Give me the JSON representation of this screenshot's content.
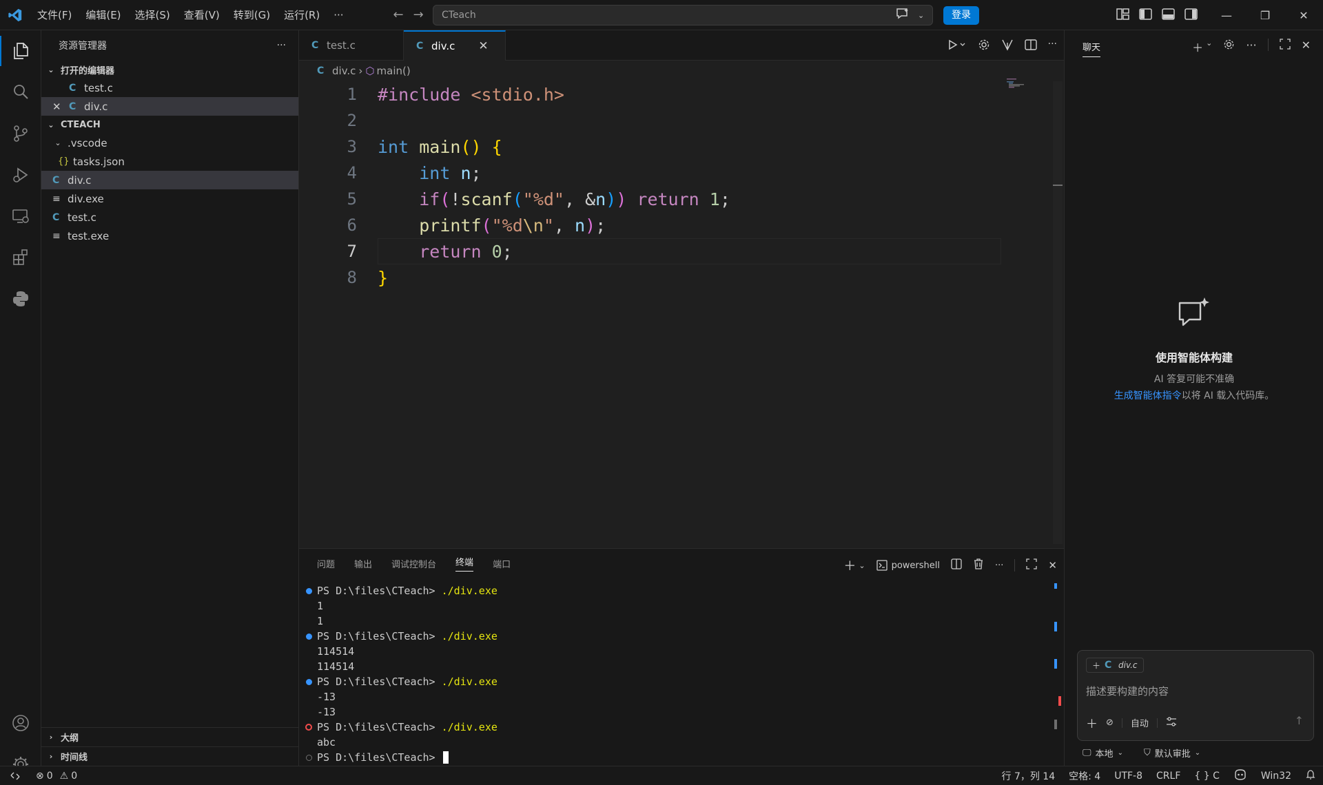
{
  "titlebar": {
    "menus": [
      "文件(F)",
      "编辑(E)",
      "选择(S)",
      "查看(V)",
      "转到(G)",
      "运行(R)",
      "···"
    ],
    "search_text": "CTeach",
    "login_label": "登录"
  },
  "sidebar": {
    "title": "资源管理器",
    "more": "···",
    "open_editors_label": "打开的编辑器",
    "open_editors": [
      {
        "name": "test.c"
      },
      {
        "name": "div.c"
      }
    ],
    "folder_label": "CTEACH",
    "tree": [
      {
        "name": ".vscode",
        "icon": "folder"
      },
      {
        "name": "tasks.json",
        "icon": "json"
      },
      {
        "name": "div.c",
        "icon": "c"
      },
      {
        "name": "div.exe",
        "icon": "exe"
      },
      {
        "name": "test.c",
        "icon": "c"
      },
      {
        "name": "test.exe",
        "icon": "exe"
      }
    ],
    "outline_label": "大纲",
    "timeline_label": "时间线"
  },
  "editor": {
    "tabs": [
      {
        "label": "test.c",
        "active": false
      },
      {
        "label": "div.c",
        "active": true
      }
    ],
    "breadcrumb": {
      "file": "div.c",
      "symbol": "main()"
    },
    "line_numbers": [
      "1",
      "2",
      "3",
      "4",
      "5",
      "6",
      "7",
      "8"
    ],
    "current_line": 7,
    "code": {
      "l1_a": "#include",
      "l1_b": " <stdio.h>",
      "l3_a": "int",
      "l3_b": "main",
      "l3_c": "()",
      "l3_d": "{",
      "l4_a": "int",
      "l4_b": "n",
      "l4_c": ";",
      "l5_a": "if",
      "l5_b": "(",
      "l5_c": "!",
      "l5_d": "scanf",
      "l5_e": "(",
      "l5_f": "\"%d\"",
      "l5_g": ", &",
      "l5_h": "n",
      "l5_i": ")",
      "l5_j": ")",
      "l5_k": "return",
      "l5_l": "1",
      "l5_m": ";",
      "l6_a": "printf",
      "l6_b": "(",
      "l6_c": "\"%d",
      "l6_d": "\\n",
      "l6_e": "\"",
      "l6_f": ", ",
      "l6_g": "n",
      "l6_h": ")",
      "l6_i": ";",
      "l7_a": "return",
      "l7_b": "0",
      "l7_c": ";",
      "l8_a": "}"
    }
  },
  "panel": {
    "tabs": [
      "问题",
      "输出",
      "调试控制台",
      "终端",
      "端口"
    ],
    "active_tab": "终端",
    "shell_label": "powershell",
    "terminal": [
      {
        "dot": "blue",
        "prompt": "PS D:\\files\\CTeach> ",
        "cmd": "./div.exe"
      },
      {
        "dot": "",
        "text": "1"
      },
      {
        "dot": "",
        "text": "1"
      },
      {
        "dot": "blue",
        "prompt": "PS D:\\files\\CTeach> ",
        "cmd": "./div.exe"
      },
      {
        "dot": "",
        "text": "114514"
      },
      {
        "dot": "",
        "text": "114514"
      },
      {
        "dot": "blue",
        "prompt": "PS D:\\files\\CTeach> ",
        "cmd": "./div.exe"
      },
      {
        "dot": "",
        "text": "-13"
      },
      {
        "dot": "",
        "text": "-13"
      },
      {
        "dot": "error",
        "prompt": "PS D:\\files\\CTeach> ",
        "cmd": "./div.exe"
      },
      {
        "dot": "",
        "text": "abc"
      },
      {
        "dot": "hollow",
        "prompt": "PS D:\\files\\CTeach> ",
        "cmd": "",
        "cursor": true
      }
    ]
  },
  "chat": {
    "title": "聊天",
    "heading": "使用智能体构建",
    "subtitle": "AI 答复可能不准确",
    "link_text": "生成智能体指令",
    "link_suffix": "以将 AI 载入代码库。",
    "context_chip": "div.c",
    "placeholder": "描述要构建的内容",
    "mode_label": "自动",
    "footer_local": "本地",
    "footer_approval": "默认审批"
  },
  "statusbar": {
    "errors": "0",
    "warnings": "0",
    "position": "行 7，列 14",
    "spaces": "空格: 4",
    "encoding": "UTF-8",
    "eol": "CRLF",
    "language": "{ } C",
    "platform": "Win32"
  },
  "colors": {
    "accent": "#0078d4",
    "background": "#1f1f1f",
    "sidebar": "#181818"
  }
}
